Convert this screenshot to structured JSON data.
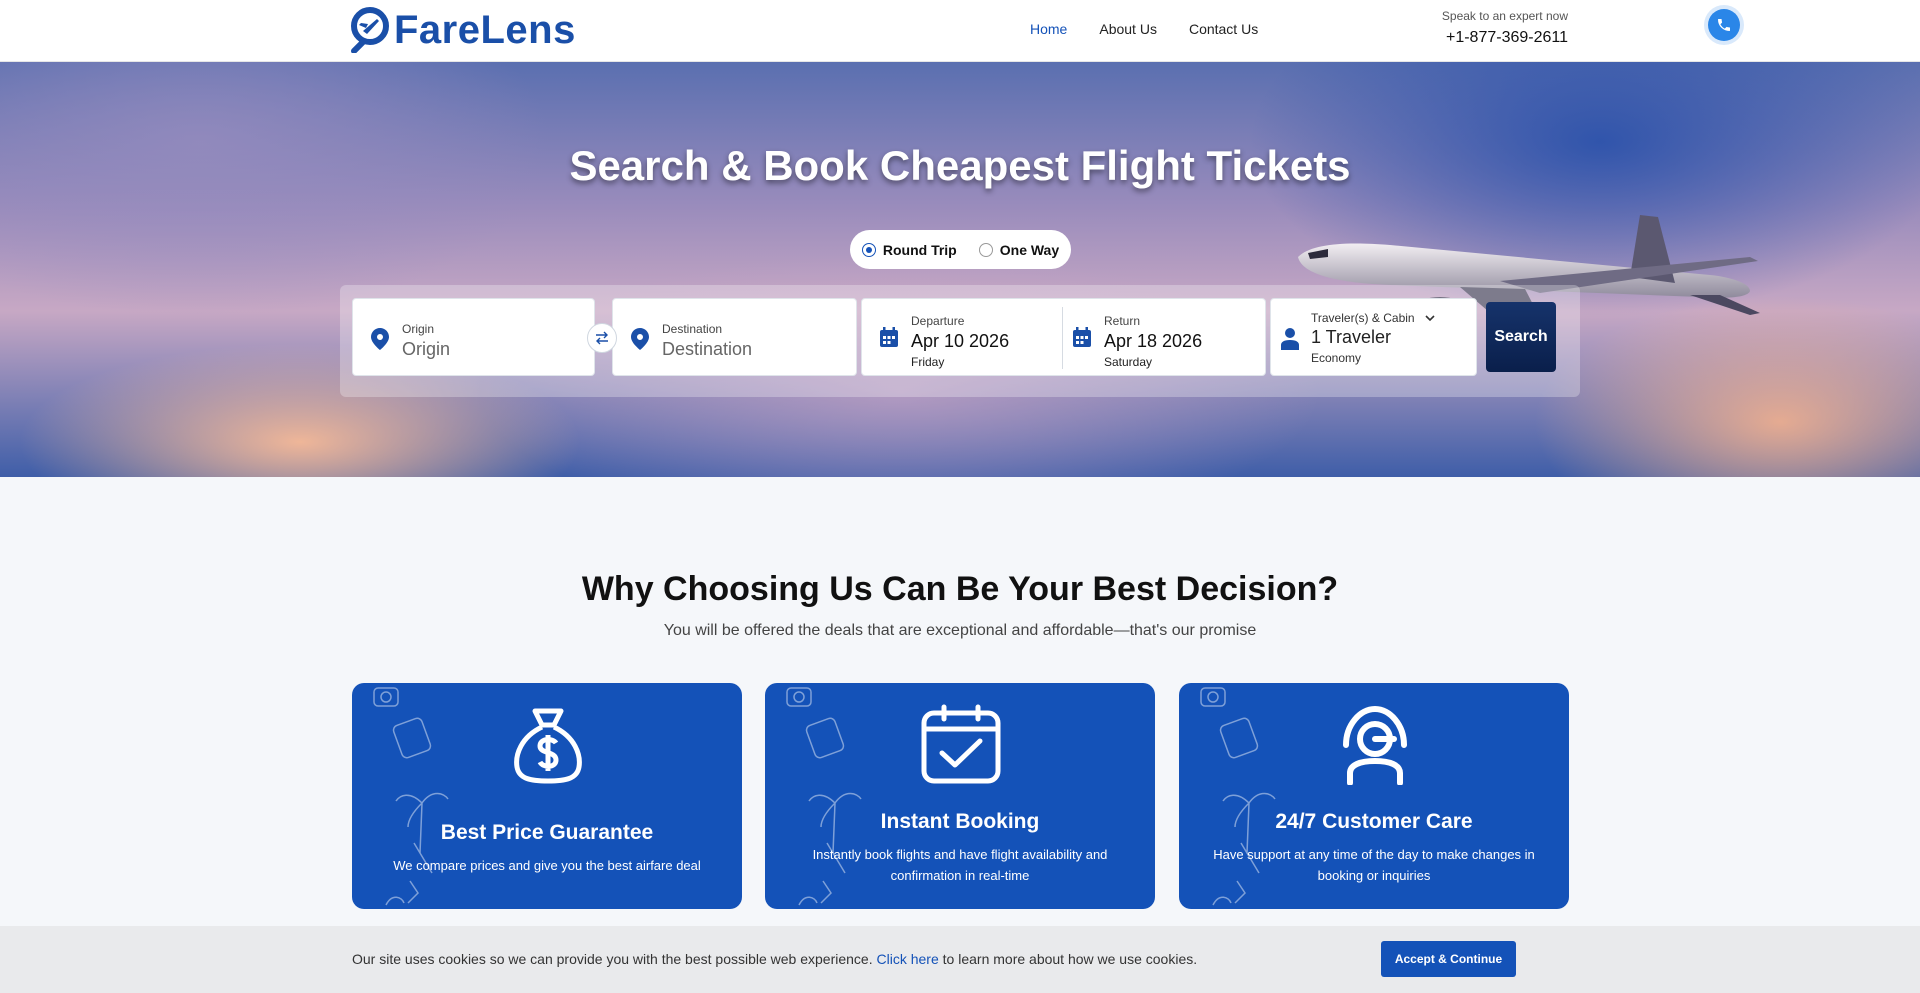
{
  "header": {
    "brand": "FareLens",
    "nav": [
      "Home",
      "About Us",
      "Contact Us"
    ],
    "active_nav": "Home",
    "phone_caption": "Speak to an expert now",
    "phone_number": "+1-877-369-2611"
  },
  "hero": {
    "title": "Search & Book Cheapest Flight Tickets",
    "trip_types": [
      "Round Trip",
      "One Way"
    ],
    "selected_trip": "Round Trip",
    "origin": {
      "label": "Origin",
      "placeholder": "Origin"
    },
    "destination": {
      "label": "Destination",
      "placeholder": "Destination"
    },
    "departure": {
      "label": "Departure",
      "date": "Apr 10 2026",
      "day": "Friday"
    },
    "return": {
      "label": "Return",
      "date": "Apr 18 2026",
      "day": "Saturday"
    },
    "travelers": {
      "label": "Traveler(s) & Cabin",
      "value": "1 Traveler",
      "cabin": "Economy"
    },
    "search_label": "Search"
  },
  "why": {
    "title": "Why Choosing Us Can Be Your Best Decision?",
    "subtitle": "You will be offered the deals that are exceptional and affordable—that's our promise",
    "cards": [
      {
        "icon": "money-bag-icon",
        "title": "Best Price Guarantee",
        "text": "We compare prices and give you the best airfare deal"
      },
      {
        "icon": "calendar-check-icon",
        "title": "Instant Booking",
        "text": "Instantly book flights and have flight availability and confirmation in real-time"
      },
      {
        "icon": "headset-support-icon",
        "title": "24/7 Customer Care",
        "text": "Have support at any time of the day to make changes in booking or inquiries"
      }
    ]
  },
  "cookie": {
    "text_before": "Our site uses cookies so we can provide you with the best possible web experience.",
    "link": "Click here",
    "text_after": "to learn more about how we use cookies.",
    "button": "Accept & Continue"
  },
  "colors": {
    "brand_blue": "#1452b8",
    "search_button": "#0a1f4b",
    "phone_blue": "#2a86e8"
  }
}
